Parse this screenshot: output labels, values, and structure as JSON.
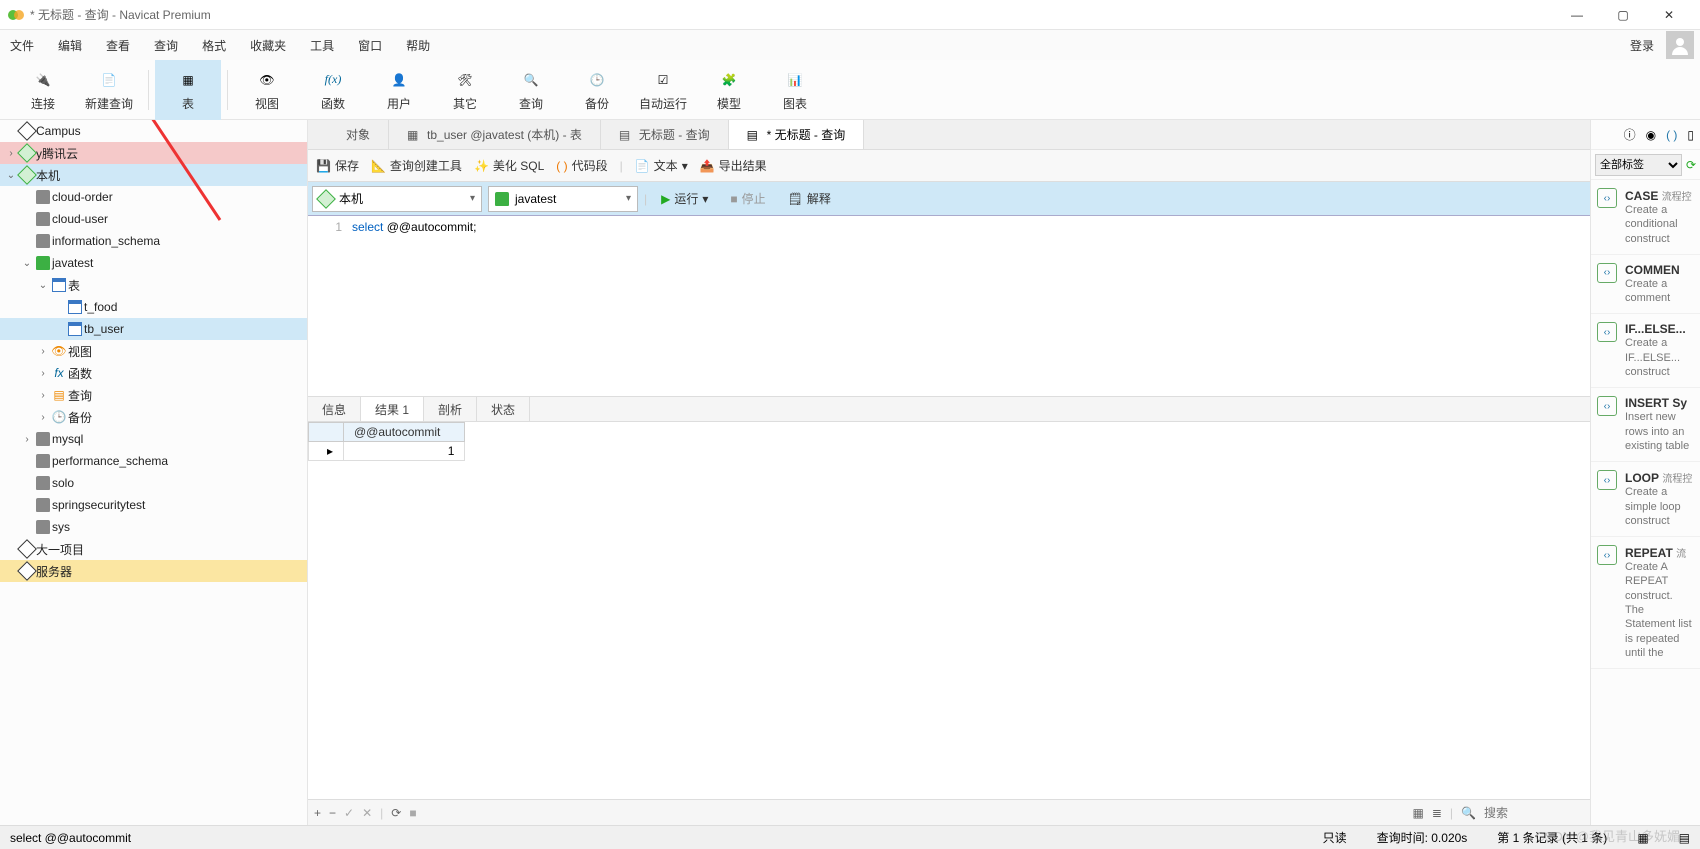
{
  "window": {
    "title": "* 无标题 - 查询 - Navicat Premium"
  },
  "menubar": {
    "items": [
      "文件",
      "编辑",
      "查看",
      "查询",
      "格式",
      "收藏夹",
      "工具",
      "窗口",
      "帮助"
    ],
    "login": "登录"
  },
  "toolbar": {
    "buttons": [
      {
        "label": "连接",
        "icon": "plug"
      },
      {
        "label": "新建查询",
        "icon": "newq"
      },
      {
        "label": "表",
        "icon": "table",
        "active": true
      },
      {
        "label": "视图",
        "icon": "view"
      },
      {
        "label": "函数",
        "icon": "fx"
      },
      {
        "label": "用户",
        "icon": "user"
      },
      {
        "label": "其它",
        "icon": "misc"
      },
      {
        "label": "查询",
        "icon": "query"
      },
      {
        "label": "备份",
        "icon": "backup"
      },
      {
        "label": "自动运行",
        "icon": "auto"
      },
      {
        "label": "模型",
        "icon": "model"
      },
      {
        "label": "图表",
        "icon": "chart"
      }
    ]
  },
  "tree": [
    {
      "label": "Campus",
      "icon": "srv",
      "depth": 0,
      "arrow": ""
    },
    {
      "label": "y腾讯云",
      "icon": "srv-grn",
      "depth": 0,
      "arrow": "›",
      "hl": "red"
    },
    {
      "label": "本机",
      "icon": "srv-grn",
      "depth": 0,
      "arrow": "⌄",
      "hl": "blue"
    },
    {
      "label": "cloud-order",
      "icon": "db",
      "depth": 1,
      "arrow": ""
    },
    {
      "label": "cloud-user",
      "icon": "db",
      "depth": 1,
      "arrow": ""
    },
    {
      "label": "information_schema",
      "icon": "db",
      "depth": 1,
      "arrow": ""
    },
    {
      "label": "javatest",
      "icon": "db-grn",
      "depth": 1,
      "arrow": "⌄"
    },
    {
      "label": "表",
      "icon": "tb",
      "depth": 2,
      "arrow": "⌄"
    },
    {
      "label": "t_food",
      "icon": "tb",
      "depth": 3,
      "arrow": ""
    },
    {
      "label": "tb_user",
      "icon": "tb",
      "depth": 3,
      "arrow": "",
      "sel": true
    },
    {
      "label": "视图",
      "icon": "view",
      "depth": 2,
      "arrow": "›"
    },
    {
      "label": "函数",
      "icon": "fx",
      "depth": 2,
      "arrow": "›"
    },
    {
      "label": "查询",
      "icon": "q",
      "depth": 2,
      "arrow": "›"
    },
    {
      "label": "备份",
      "icon": "bk",
      "depth": 2,
      "arrow": "›"
    },
    {
      "label": "mysql",
      "icon": "db",
      "depth": 1,
      "arrow": "›"
    },
    {
      "label": "performance_schema",
      "icon": "db",
      "depth": 1,
      "arrow": ""
    },
    {
      "label": "solo",
      "icon": "db",
      "depth": 1,
      "arrow": ""
    },
    {
      "label": "springsecuritytest",
      "icon": "db",
      "depth": 1,
      "arrow": ""
    },
    {
      "label": "sys",
      "icon": "db",
      "depth": 1,
      "arrow": ""
    },
    {
      "label": "大一项目",
      "icon": "srv",
      "depth": 0,
      "arrow": ""
    },
    {
      "label": "服务器",
      "icon": "srv",
      "depth": 0,
      "arrow": "",
      "hl": "yellow"
    }
  ],
  "tabs": [
    {
      "label": "对象",
      "icon": "obj"
    },
    {
      "label": "tb_user @javatest (本机) - 表",
      "icon": "tb"
    },
    {
      "label": "无标题 - 查询",
      "icon": "q"
    },
    {
      "label": "* 无标题 - 查询",
      "icon": "q",
      "active": true
    }
  ],
  "querybar": {
    "save": "保存",
    "tool": "查询创建工具",
    "beautify": "美化 SQL",
    "snip": "代码段",
    "text": "文本",
    "export": "导出结果"
  },
  "connbar": {
    "conn": "本机",
    "db": "javatest",
    "run": "运行",
    "stop": "停止",
    "explain": "解释"
  },
  "editor": {
    "line": "1",
    "sql_kw": "select",
    "sql_rest": " @@autocommit;"
  },
  "restabs": [
    "信息",
    "结果 1",
    "剖析",
    "状态"
  ],
  "grid": {
    "header": "@@autocommit",
    "row": "1"
  },
  "status": {
    "sql": "select @@autocommit",
    "ro": "只读",
    "qt": "查询时间: 0.020s",
    "rec": "第 1 条记录 (共 1 条)"
  },
  "rightpanel": {
    "filter": "全部标签",
    "snippets": [
      {
        "t": "CASE",
        "sub": "流程控",
        "d": "Create a conditional construct"
      },
      {
        "t": "COMMEN",
        "sub": "",
        "d": "Create a comment"
      },
      {
        "t": "IF...ELSE...",
        "sub": "",
        "d": "Create a IF...ELSE... construct"
      },
      {
        "t": "INSERT Sy",
        "sub": "",
        "d": "Insert new rows into an existing table"
      },
      {
        "t": "LOOP",
        "sub": "流程控",
        "d": "Create a simple loop construct"
      },
      {
        "t": "REPEAT",
        "sub": "流",
        "d": "Create A REPEAT construct. The Statement list is repeated until the"
      }
    ],
    "search": "搜索"
  },
  "watermark": "CSDN @我见青山多妩媚"
}
